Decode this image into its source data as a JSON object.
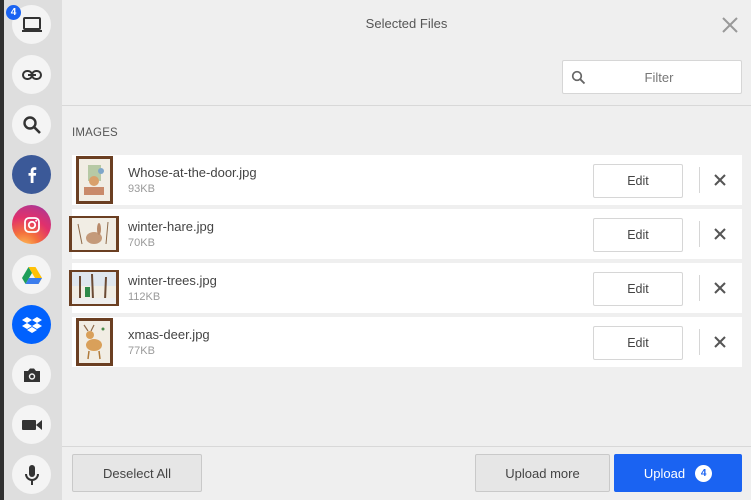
{
  "sidebar": {
    "badge_count": "4",
    "sources": [
      {
        "name": "my-device",
        "icon": "laptop-icon",
        "active": true
      },
      {
        "name": "link",
        "icon": "link-icon"
      },
      {
        "name": "web-search",
        "icon": "search-icon"
      },
      {
        "name": "facebook",
        "icon": "facebook-icon",
        "color": "#3b5998"
      },
      {
        "name": "instagram",
        "icon": "instagram-icon",
        "color": "#e1306c"
      },
      {
        "name": "google-drive",
        "icon": "google-drive-icon"
      },
      {
        "name": "dropbox",
        "icon": "dropbox-icon",
        "color": "#0061fe"
      },
      {
        "name": "camera",
        "icon": "camera-icon"
      },
      {
        "name": "video",
        "icon": "video-icon"
      },
      {
        "name": "audio",
        "icon": "microphone-icon"
      }
    ]
  },
  "header": {
    "title": "Selected Files",
    "close_icon": "close-icon"
  },
  "filter": {
    "placeholder": "Filter",
    "value": ""
  },
  "section_label": "IMAGES",
  "files": [
    {
      "name": "Whose-at-the-door.jpg",
      "size": "93KB",
      "edit_label": "Edit"
    },
    {
      "name": "winter-hare.jpg",
      "size": "70KB",
      "edit_label": "Edit"
    },
    {
      "name": "winter-trees.jpg",
      "size": "112KB",
      "edit_label": "Edit"
    },
    {
      "name": "xmas-deer.jpg",
      "size": "77KB",
      "edit_label": "Edit"
    }
  ],
  "footer": {
    "deselect_label": "Deselect All",
    "upload_more_label": "Upload more",
    "upload_label": "Upload",
    "upload_count": "4"
  },
  "colors": {
    "accent": "#1a63f2",
    "facebook": "#3b5998",
    "dropbox": "#0061fe"
  }
}
